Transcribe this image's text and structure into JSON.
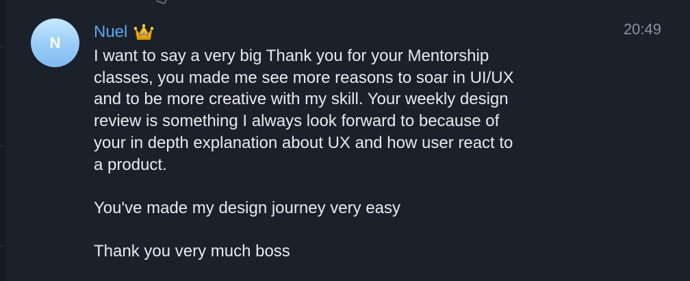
{
  "message": {
    "avatar_initial": "N",
    "sender_name": "Nuel",
    "sender_badge": "crown-icon",
    "timestamp": "20:49",
    "paragraphs": [
      "I want to say a very big Thank you for your Mentorship\nclasses, you made me see more reasons to soar in UI/UX\nand to be more creative with my skill. Your weekly design\nreview is something I always look forward to because of\nyour in depth explanation about UX and how user react to\na product.",
      "You've made my design journey very easy",
      "Thank you very much boss"
    ]
  },
  "colors": {
    "background": "#1b212b",
    "sender_name": "#5aa9ee",
    "message_text": "#e8eaed",
    "timestamp": "#8a929e",
    "avatar_gradient_top": "#c7e9ff",
    "avatar_gradient_bottom": "#7fbbef"
  }
}
